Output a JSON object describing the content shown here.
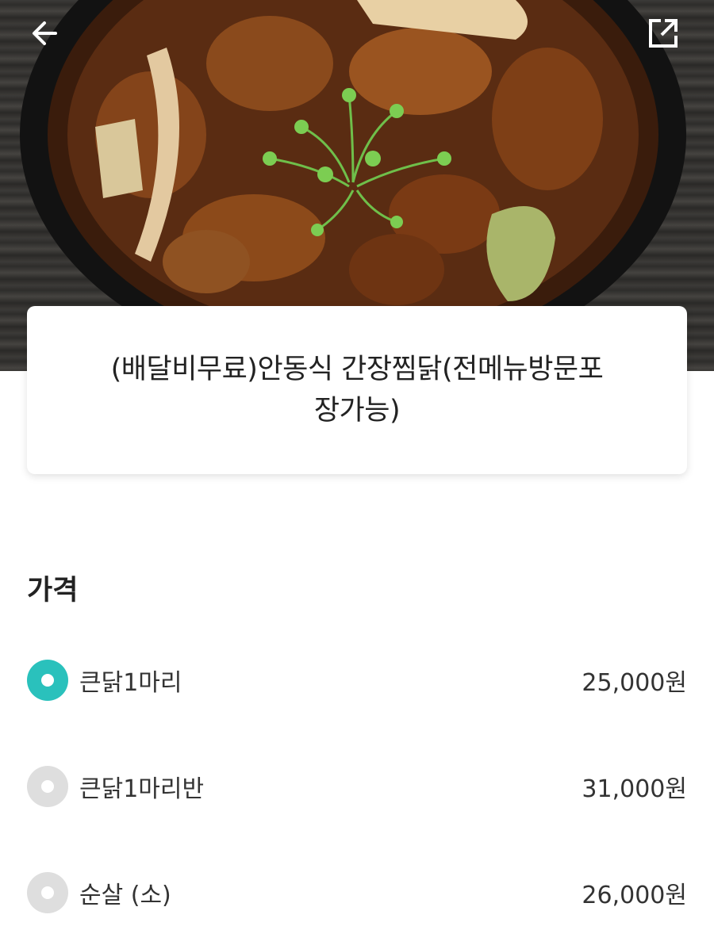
{
  "header": {
    "back_icon": "arrow-left-icon",
    "share_icon": "external-share-icon"
  },
  "menu": {
    "title": "(배달비무료)안동식 간장찜닭(전메뉴방문포장가능)"
  },
  "price_section": {
    "title": "가격",
    "options": [
      {
        "label": "큰닭1마리",
        "price": "25,000원",
        "selected": true
      },
      {
        "label": "큰닭1마리반",
        "price": "31,000원",
        "selected": false
      },
      {
        "label": "순살 (소)",
        "price": "26,000원",
        "selected": false
      }
    ]
  },
  "colors": {
    "accent": "#2ac1bc",
    "radio_unselected": "#dedede"
  }
}
